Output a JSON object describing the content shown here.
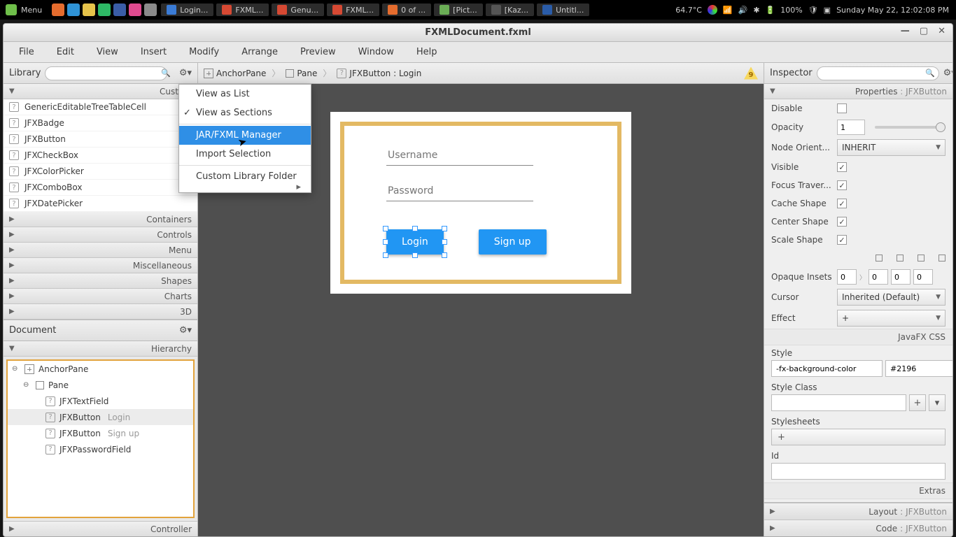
{
  "sysbar": {
    "menu": "Menu",
    "tasks": [
      "Login...",
      "FXML...",
      "Genu...",
      "FXML...",
      "0 of ...",
      "[Pict...",
      "[Kaz...",
      "Untitl..."
    ],
    "temp": "64.7°C",
    "battery": "100%",
    "datetime": "Sunday May 22, 12:02:08 PM"
  },
  "window": {
    "title": "FXMLDocument.fxml"
  },
  "menus": [
    "File",
    "Edit",
    "View",
    "Insert",
    "Modify",
    "Arrange",
    "Preview",
    "Window",
    "Help"
  ],
  "library": {
    "title": "Library",
    "cat_custom": "Custom",
    "items": [
      "GenericEditableTreeTableCell",
      "JFXBadge",
      "JFXButton",
      "JFXCheckBox",
      "JFXColorPicker",
      "JFXComboBox",
      "JFXDatePicker"
    ],
    "cats": [
      "Containers",
      "Controls",
      "Menu",
      "Miscellaneous",
      "Shapes",
      "Charts",
      "3D"
    ]
  },
  "document": {
    "title": "Document",
    "hierarchy": "Hierarchy",
    "controller": "Controller",
    "root": "AnchorPane",
    "pane": "Pane",
    "children": [
      {
        "name": "JFXTextField",
        "hint": ""
      },
      {
        "name": "JFXButton",
        "hint": "Login"
      },
      {
        "name": "JFXButton",
        "hint": "Sign up"
      },
      {
        "name": "JFXPasswordField",
        "hint": ""
      }
    ]
  },
  "breadcrumb": {
    "a": "AnchorPane",
    "b": "Pane",
    "c": "JFXButton : Login",
    "warn": "9"
  },
  "form": {
    "user_ph": "Username",
    "pass_ph": "Password",
    "login": "Login",
    "signup": "Sign up"
  },
  "popup": {
    "i1": "View as List",
    "i2": "View as Sections",
    "i3": "JAR/FXML Manager",
    "i4": "Import Selection",
    "i5": "Custom Library Folder"
  },
  "inspector": {
    "title": "Inspector",
    "section": "Properties",
    "section_sub": "JFXButton",
    "disable": "Disable",
    "opacity": "Opacity",
    "opacity_val": "1",
    "node": "Node Orient...",
    "node_val": "INHERIT",
    "visible": "Visible",
    "focus": "Focus Traver...",
    "cache": "Cache Shape",
    "center": "Center Shape",
    "scale": "Scale Shape",
    "opaque": "Opaque Insets",
    "oi": "0",
    "cursor": "Cursor",
    "cursor_val": "Inherited (Default)",
    "effect": "Effect",
    "jfxcss": "JavaFX CSS",
    "style": "Style",
    "style_a": "-fx-background-color",
    "style_b": "#2196",
    "styleclass": "Style Class",
    "stylesheets": "Stylesheets",
    "id": "Id",
    "extras": "Extras",
    "layout": "Layout",
    "layout_sub": "JFXButton",
    "code": "Code",
    "code_sub": "JFXButton"
  }
}
